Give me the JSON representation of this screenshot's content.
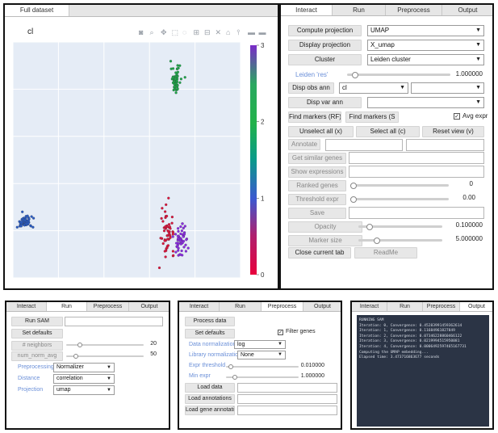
{
  "colors": {
    "plot_bg": "#e5ecf6",
    "console_bg": "#2b3445",
    "console_text": "#d8dde6",
    "accent_blue": "#6a8fd8",
    "cluster0": "#dc143c",
    "cluster1": "#2a5cc4",
    "cluster2": "#8a2be2",
    "cluster3": "#1ea64a"
  },
  "plot_panel": {
    "tab": "Full dataset",
    "plot_title": "cl",
    "toolbar_icons": [
      "camera-icon",
      "zoom-icon",
      "pan-icon",
      "box-select-icon",
      "lasso-icon",
      "zoom-in-icon",
      "zoom-out-icon",
      "autoscale-icon",
      "reset-axes-icon",
      "spike-lines-icon",
      "compare-icon",
      "closest-icon"
    ],
    "colorbar": {
      "ticks": [
        {
          "v": 3,
          "label": "3"
        },
        {
          "v": 2,
          "label": "2"
        },
        {
          "v": 1,
          "label": "1"
        },
        {
          "v": 0,
          "label": "0"
        }
      ],
      "min": 0,
      "max": 3
    }
  },
  "chart_data": {
    "type": "scatter",
    "title": "cl",
    "xlabel": "",
    "ylabel": "",
    "xlim": [
      -10,
      10
    ],
    "ylim": [
      -10,
      10
    ],
    "grid": true,
    "colorbar": {
      "range": [
        0,
        3
      ],
      "ticks": [
        0,
        1,
        2,
        3
      ],
      "colormap": "hsv-like"
    },
    "clusters": [
      {
        "cluster": 3,
        "center": [
          4.3,
          6.8
        ],
        "spread": [
          0.35,
          0.9
        ],
        "n": 60
      },
      {
        "cluster": 1,
        "center": [
          -9.0,
          -5.3
        ],
        "spread": [
          0.55,
          0.45
        ],
        "n": 55
      },
      {
        "cluster": 2,
        "center": [
          4.8,
          -6.8
        ],
        "spread": [
          0.55,
          1.3
        ],
        "n": 55
      },
      {
        "cluster": 0,
        "center": [
          3.6,
          -6.0
        ],
        "spread": [
          0.45,
          1.5
        ],
        "n": 55
      }
    ]
  },
  "interact": {
    "tabs": [
      "Interact",
      "Run",
      "Preprocess",
      "Output"
    ],
    "compute_projection": "Compute projection",
    "compute_value": "UMAP",
    "display_projection": "Display projection",
    "display_value": "X_umap",
    "cluster": "Cluster",
    "cluster_value": "Leiden cluster",
    "leiden_label": "Leiden 'res'",
    "leiden_value": "1.000000",
    "leiden_frac": 0.05,
    "disp_obs": "Disp obs ann",
    "disp_obs_value": "cl",
    "disp_obs_value2": "",
    "disp_var": "Disp var ann",
    "disp_var_value": "",
    "find_markers_rf": "Find markers (RF)",
    "find_markers_s": "Find markers (S",
    "avg_expr": "Avg expr",
    "unselect": "Unselect all (x)",
    "select_all": "Select all (c)",
    "reset_view": "Reset view (v)",
    "annotate": "Annotate",
    "similar": "Get similar genes",
    "show_expr": "Show expressions",
    "ranked": "Ranked genes",
    "ranked_value": "0",
    "ranked_frac": 0,
    "threshold": "Threshold expr",
    "threshold_value": "0.00",
    "threshold_frac": 0,
    "save": "Save",
    "opacity": "Opacity",
    "opacity_value": "0.100000",
    "opacity_frac": 0.1,
    "marker": "Marker size",
    "marker_value": "5.000000",
    "marker_frac": 0.2,
    "close_tab": "Close current tab",
    "readme": "ReadMe"
  },
  "run_panel": {
    "tabs": [
      "Interact",
      "Run",
      "Preprocess",
      "Output"
    ],
    "run_sam": "Run SAM",
    "set_defaults": "Set defaults",
    "neighbors": "# neighbors",
    "neighbors_value": "20",
    "neighbors_frac": 0.15,
    "num_norm": "num_norm_avg",
    "num_norm_value": "50",
    "num_norm_frac": 0.1,
    "preprocessing": "Preprocessing",
    "preprocessing_value": "Normalizer",
    "distance": "Distance",
    "distance_value": "correlation",
    "projection": "Projection",
    "projection_value": "umap"
  },
  "pre_panel": {
    "tabs": [
      "Interact",
      "Run",
      "Preprocess",
      "Output"
    ],
    "process": "Process data",
    "set_defaults": "Set defaults",
    "filter": "Filter genes",
    "data_norm": "Data normalization",
    "data_norm_value": "log",
    "lib_norm": "Library normalization",
    "lib_norm_value": "None",
    "expr_thresh": "Expr threshold",
    "expr_thresh_value": "0.010000",
    "expr_thresh_frac": 0.03,
    "min_expr": "Min expr",
    "min_expr_value": "1.000000",
    "min_expr_frac": 0.1,
    "load_data": "Load data",
    "load_ann": "Load annotations",
    "load_gene": "Load gene annotati..."
  },
  "out_panel": {
    "tabs": [
      "Interact",
      "Run",
      "Preprocess",
      "Output"
    ],
    "lines": [
      "RUNNING SAM",
      "Iteration: 0, Convergence: 0.45283991459362614",
      "Iteration: 1, Convergence: 0.11684961827849",
      "Iteration: 2, Convergence: 0.07346228860466122",
      "Iteration: 3, Convergence: 0.0219994515950081",
      "Iteration: 4, Convergence: 0.0006492597465167731",
      "Computing the UMAP embedding...",
      "Elapsed time: 3.473716863677 seconds"
    ]
  }
}
